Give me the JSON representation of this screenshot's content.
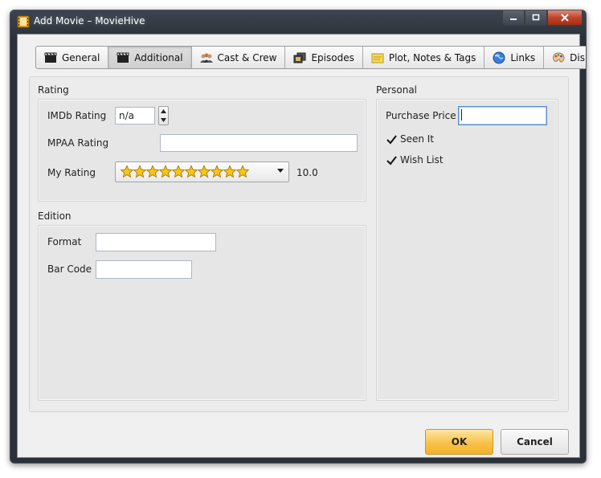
{
  "window": {
    "title": "Add Movie – MovieHive"
  },
  "tabs": [
    {
      "label": "General",
      "icon": "clapperboard-icon"
    },
    {
      "label": "Additional",
      "icon": "clapperboard-icon",
      "active": true
    },
    {
      "label": "Cast & Crew",
      "icon": "people-icon"
    },
    {
      "label": "Episodes",
      "icon": "film-stack-icon"
    },
    {
      "label": "Plot, Notes & Tags",
      "icon": "note-icon"
    },
    {
      "label": "Links",
      "icon": "globe-icon"
    },
    {
      "label": "Display",
      "icon": "palette-icon"
    }
  ],
  "rating": {
    "group_label": "Rating",
    "imdb_label": "IMDb Rating",
    "imdb_value": "n/a",
    "mpaa_label": "MPAA Rating",
    "mpaa_value": "",
    "my_rating_label": "My Rating",
    "my_rating_stars": 10,
    "my_rating_value": "10.0"
  },
  "edition": {
    "group_label": "Edition",
    "format_label": "Format",
    "format_value": "",
    "barcode_label": "Bar Code",
    "barcode_value": ""
  },
  "personal": {
    "group_label": "Personal",
    "purchase_price_label": "Purchase Price",
    "purchase_price_value": "",
    "seen_it_label": "Seen It",
    "seen_it_checked": true,
    "wish_list_label": "Wish List",
    "wish_list_checked": true
  },
  "buttons": {
    "ok_label": "OK",
    "cancel_label": "Cancel"
  },
  "colors": {
    "ok_button": "#f8c24a",
    "star_fill": "#f5c518",
    "title_bar": "#2e343c"
  }
}
